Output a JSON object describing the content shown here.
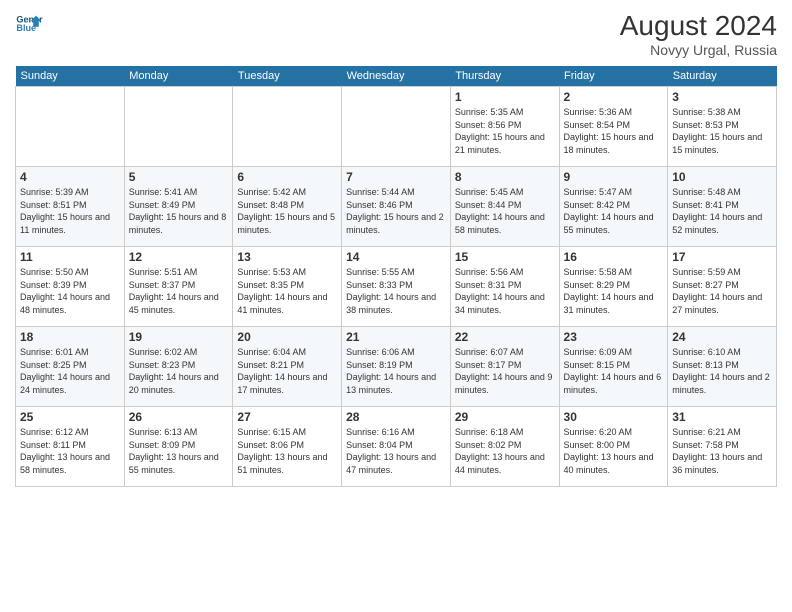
{
  "header": {
    "logo_line1": "General",
    "logo_line2": "Blue",
    "month_year": "August 2024",
    "location": "Novyy Urgal, Russia"
  },
  "days_of_week": [
    "Sunday",
    "Monday",
    "Tuesday",
    "Wednesday",
    "Thursday",
    "Friday",
    "Saturday"
  ],
  "weeks": [
    [
      null,
      null,
      null,
      null,
      {
        "day": 1,
        "sunrise": "5:35 AM",
        "sunset": "8:56 PM",
        "daylight": "15 hours and 21 minutes."
      },
      {
        "day": 2,
        "sunrise": "5:36 AM",
        "sunset": "8:54 PM",
        "daylight": "15 hours and 18 minutes."
      },
      {
        "day": 3,
        "sunrise": "5:38 AM",
        "sunset": "8:53 PM",
        "daylight": "15 hours and 15 minutes."
      }
    ],
    [
      {
        "day": 4,
        "sunrise": "5:39 AM",
        "sunset": "8:51 PM",
        "daylight": "15 hours and 11 minutes."
      },
      {
        "day": 5,
        "sunrise": "5:41 AM",
        "sunset": "8:49 PM",
        "daylight": "15 hours and 8 minutes."
      },
      {
        "day": 6,
        "sunrise": "5:42 AM",
        "sunset": "8:48 PM",
        "daylight": "15 hours and 5 minutes."
      },
      {
        "day": 7,
        "sunrise": "5:44 AM",
        "sunset": "8:46 PM",
        "daylight": "15 hours and 2 minutes."
      },
      {
        "day": 8,
        "sunrise": "5:45 AM",
        "sunset": "8:44 PM",
        "daylight": "14 hours and 58 minutes."
      },
      {
        "day": 9,
        "sunrise": "5:47 AM",
        "sunset": "8:42 PM",
        "daylight": "14 hours and 55 minutes."
      },
      {
        "day": 10,
        "sunrise": "5:48 AM",
        "sunset": "8:41 PM",
        "daylight": "14 hours and 52 minutes."
      }
    ],
    [
      {
        "day": 11,
        "sunrise": "5:50 AM",
        "sunset": "8:39 PM",
        "daylight": "14 hours and 48 minutes."
      },
      {
        "day": 12,
        "sunrise": "5:51 AM",
        "sunset": "8:37 PM",
        "daylight": "14 hours and 45 minutes."
      },
      {
        "day": 13,
        "sunrise": "5:53 AM",
        "sunset": "8:35 PM",
        "daylight": "14 hours and 41 minutes."
      },
      {
        "day": 14,
        "sunrise": "5:55 AM",
        "sunset": "8:33 PM",
        "daylight": "14 hours and 38 minutes."
      },
      {
        "day": 15,
        "sunrise": "5:56 AM",
        "sunset": "8:31 PM",
        "daylight": "14 hours and 34 minutes."
      },
      {
        "day": 16,
        "sunrise": "5:58 AM",
        "sunset": "8:29 PM",
        "daylight": "14 hours and 31 minutes."
      },
      {
        "day": 17,
        "sunrise": "5:59 AM",
        "sunset": "8:27 PM",
        "daylight": "14 hours and 27 minutes."
      }
    ],
    [
      {
        "day": 18,
        "sunrise": "6:01 AM",
        "sunset": "8:25 PM",
        "daylight": "14 hours and 24 minutes."
      },
      {
        "day": 19,
        "sunrise": "6:02 AM",
        "sunset": "8:23 PM",
        "daylight": "14 hours and 20 minutes."
      },
      {
        "day": 20,
        "sunrise": "6:04 AM",
        "sunset": "8:21 PM",
        "daylight": "14 hours and 17 minutes."
      },
      {
        "day": 21,
        "sunrise": "6:06 AM",
        "sunset": "8:19 PM",
        "daylight": "14 hours and 13 minutes."
      },
      {
        "day": 22,
        "sunrise": "6:07 AM",
        "sunset": "8:17 PM",
        "daylight": "14 hours and 9 minutes."
      },
      {
        "day": 23,
        "sunrise": "6:09 AM",
        "sunset": "8:15 PM",
        "daylight": "14 hours and 6 minutes."
      },
      {
        "day": 24,
        "sunrise": "6:10 AM",
        "sunset": "8:13 PM",
        "daylight": "14 hours and 2 minutes."
      }
    ],
    [
      {
        "day": 25,
        "sunrise": "6:12 AM",
        "sunset": "8:11 PM",
        "daylight": "13 hours and 58 minutes."
      },
      {
        "day": 26,
        "sunrise": "6:13 AM",
        "sunset": "8:09 PM",
        "daylight": "13 hours and 55 minutes."
      },
      {
        "day": 27,
        "sunrise": "6:15 AM",
        "sunset": "8:06 PM",
        "daylight": "13 hours and 51 minutes."
      },
      {
        "day": 28,
        "sunrise": "6:16 AM",
        "sunset": "8:04 PM",
        "daylight": "13 hours and 47 minutes."
      },
      {
        "day": 29,
        "sunrise": "6:18 AM",
        "sunset": "8:02 PM",
        "daylight": "13 hours and 44 minutes."
      },
      {
        "day": 30,
        "sunrise": "6:20 AM",
        "sunset": "8:00 PM",
        "daylight": "13 hours and 40 minutes."
      },
      {
        "day": 31,
        "sunrise": "6:21 AM",
        "sunset": "7:58 PM",
        "daylight": "13 hours and 36 minutes."
      }
    ]
  ],
  "labels": {
    "sunrise": "Sunrise:",
    "sunset": "Sunset:",
    "daylight": "Daylight:"
  }
}
